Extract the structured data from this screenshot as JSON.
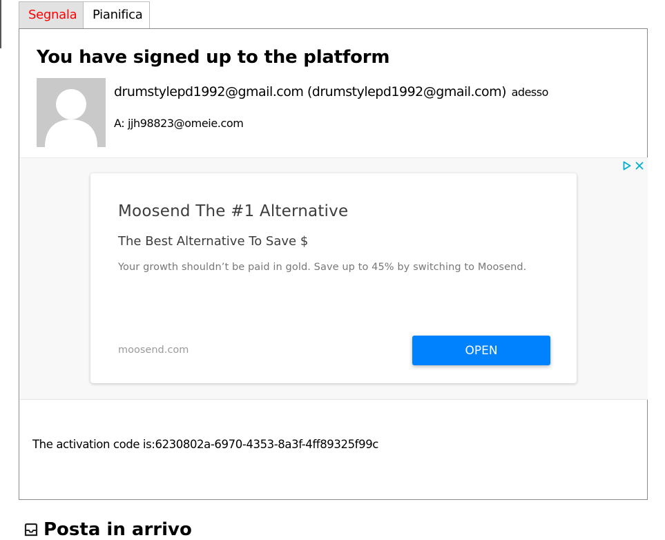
{
  "tabs": [
    {
      "label": "Segnala",
      "color": "#ff0000"
    },
    {
      "label": "Pianifica"
    }
  ],
  "email": {
    "subject": "You have signed up to the platform",
    "sender": "drumstylepd1992@gmail.com (drumstylepd1992@gmail.com)",
    "time": "adesso",
    "to": "A: jjh98823@omeie.com",
    "body": "The activation code is:6230802a-6970-4353-8a3f-4ff89325f99c"
  },
  "ad": {
    "title": "Moosend The #1 Alternative",
    "subtitle": "The Best Alternative To Save $",
    "description": "Your growth shouldn’t be paid in gold. Save up to 45% by switching to Moosend.",
    "domain": "moosend.com",
    "button_label": "OPEN",
    "button_color": "#0082ff",
    "icons": [
      "adchoices-icon",
      "close-icon"
    ]
  },
  "inbox": {
    "heading": "Posta in arrivo",
    "icon": "inbox-icon"
  }
}
